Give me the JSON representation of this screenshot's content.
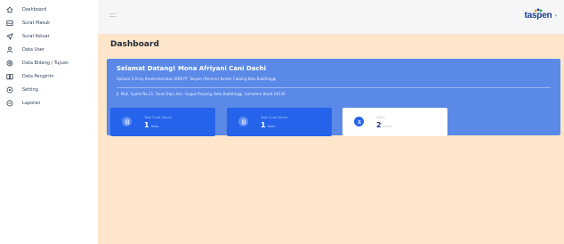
{
  "sidebar": {
    "items": [
      {
        "label": "Dashboard",
        "icon": "home-icon"
      },
      {
        "label": "Surat Masuk",
        "icon": "mail-icon"
      },
      {
        "label": "Surat Keluar",
        "icon": "send-icon"
      },
      {
        "label": "Data User",
        "icon": "user-icon"
      },
      {
        "label": "Data Bidang / Tujuan",
        "icon": "target-icon"
      },
      {
        "label": "Data Pengirim",
        "icon": "book-icon"
      },
      {
        "label": "Setting",
        "icon": "gear-icon"
      },
      {
        "label": "Laporan",
        "icon": "report-icon"
      }
    ]
  },
  "topbar": {
    "brand": "taspen",
    "menu_icon": "hamburger-icon",
    "caret_icon": "chevron-down-icon"
  },
  "main": {
    "title": "Dashboard",
    "welcome": {
      "title": "Selamat Datang! Mona Afriyani Cani Dachi",
      "subtitle": "Aplikasi E-Arsip Kesekretariatan SDM PT. Taspen (Persero) Kantor Cabang Kota Bukittinggi",
      "address": "Jl. Moh. Syafei No.11, Tarok Dipo, Kec. Guguk Panjang, Kota Bukittinggi, Sumatera Barat 26136"
    },
    "cards": [
      {
        "title": "Total Surat Masuk",
        "value": "1",
        "unit": "Arsip",
        "icon": "document-icon"
      },
      {
        "title": "Total Surat Keluar",
        "value": "1",
        "unit": "Arsip",
        "icon": "document-icon"
      },
      {
        "title": "Users",
        "value": "2",
        "unit": "Users",
        "icon": "user-icon"
      }
    ]
  },
  "colors": {
    "primary": "#2563eb",
    "welcome_bg": "#5b89e8",
    "content_bg": "#fde6ca",
    "brand": "#1b3d8f"
  }
}
